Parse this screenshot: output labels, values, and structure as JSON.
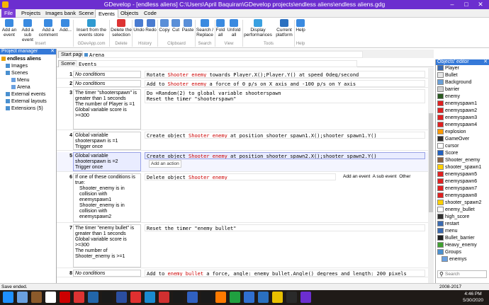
{
  "window": {
    "title": "GDevelop - [endless aliens] C:\\Users\\April Baquiran\\GDevelop projects\\endless aliens\\endless aliens.gdg"
  },
  "menu": [
    "File",
    "Projects",
    "Images bank",
    "Scene",
    "Events",
    "Objects",
    "Code"
  ],
  "ribbon": {
    "buttons": [
      "Add an event",
      "Add a sub event",
      "Add a comment",
      "Add...",
      "Insert from the events store",
      "Delete the selection",
      "Undo",
      "Redo",
      "Copy",
      "Cut",
      "Paste",
      "Search / Replace",
      "Fold all",
      "Unfold all",
      "Display performances",
      "Current platform",
      "Help"
    ],
    "groups": [
      "Insert",
      "GDevApp.com",
      "Delete",
      "History",
      "Clipboard",
      "Search",
      "View",
      "Tools",
      "Help"
    ]
  },
  "left_panel": {
    "title": "Project manager",
    "items": [
      "endless aliens",
      "Images",
      "Scenes",
      "Menu",
      "Arena",
      "External events",
      "External layouts",
      "Extensions (5)"
    ]
  },
  "tabs": [
    "Start page",
    "Arena"
  ],
  "subtabs": [
    "Scene",
    "Events"
  ],
  "events": {
    "e1": {
      "num": "1",
      "cond": "No conditions",
      "act_pre": "Rotate ",
      "act_obj": "Shooter_enemy",
      "act_post": " towards Player.X();Player.Y() at speed 0deg/second"
    },
    "e2": {
      "num": "2",
      "cond": "No conditions",
      "act_pre": "Add to ",
      "act_obj": "Shooter_enemy",
      "act_post": " a force of 0 p/s on X axis and -100 p/s on Y axis"
    },
    "e3": {
      "num": "3",
      "cond1": "The timer \"shooterspawn\" is greater than 1 seconds",
      "cond2": "The number of Player is =1",
      "cond3": "Global variable score is >=300",
      "act1": "Do =Random(2) to global variable shooterspawn",
      "act2": "Reset the timer \"shooterspawn\""
    },
    "e4": {
      "num": "4",
      "cond1": "Global variable shooterspawn is =1",
      "cond2": "Trigger once",
      "act_pre": "Create object ",
      "act_obj": "Shooter_enemy",
      "act_post": " at position shooter_spawn1.X();shooter_spawn1.Y()"
    },
    "e5": {
      "num": "5",
      "cond1": "Global variable shooterspawn is =2",
      "cond2": "Trigger once",
      "act_pre": "Create object ",
      "act_obj": "Shooter_enemy",
      "act_post": " at position shooter_spawn2.X();shooter_spawn2.Y()",
      "add_action": "Add an action"
    },
    "e6": {
      "num": "6",
      "cond1": "If one of these conditions is true:",
      "cond2": "Shooter_enemy is in collision with enemyspawn1",
      "cond3": "Shooter_enemy is in collision with enemyspawn2",
      "act_pre": "Delete object ",
      "act_obj": "Shooter_enemy",
      "links": [
        "Add an event",
        "A sub event",
        "Other"
      ]
    },
    "e7": {
      "num": "7",
      "cond1": "The timer \"enemy bullet\" is greater than 1 seconds",
      "cond2": "Global variable score is >=300",
      "cond3": "The number of Shooter_enemy is >=1",
      "act": "Reset the timer \"enemy bullet\""
    },
    "e8": {
      "num": "8",
      "cond": "No conditions",
      "act_pre": "Add to ",
      "act_obj": "enemy_bullet",
      "act_post": " a force, angle: enemy_bullet.Angle() degrees and length: 200 pixels"
    }
  },
  "right_panel": {
    "title": "Objects' editor",
    "items": [
      "Player",
      "Bullet",
      "Background",
      "barrier",
      "enemy",
      "enemyspawn1",
      "enemyspawn2",
      "enemyspawn3",
      "enemyspawn4",
      "explosion",
      "GameOver",
      "cursor",
      "Score",
      "Shooter_enemy",
      "shooter_spawn1",
      "enemyspawn5",
      "enemyspawn6",
      "enemyspawn7",
      "enemyspawn8",
      "shooter_spawn2",
      "enemy_bullet",
      "high_score",
      "restart",
      "menu",
      "Bullet_barrier",
      "Heavy_enemy"
    ],
    "groups_label": "Groups",
    "groups_item": "enemys",
    "search_placeholder": "Search"
  },
  "status": {
    "left": "Save ended.",
    "right": "2008-2017"
  },
  "clock": {
    "time": "4:46 PM",
    "date": "5/30/2020"
  },
  "colors": {
    "accent": "#6c2ecf",
    "panel_header": "#3579d8"
  }
}
